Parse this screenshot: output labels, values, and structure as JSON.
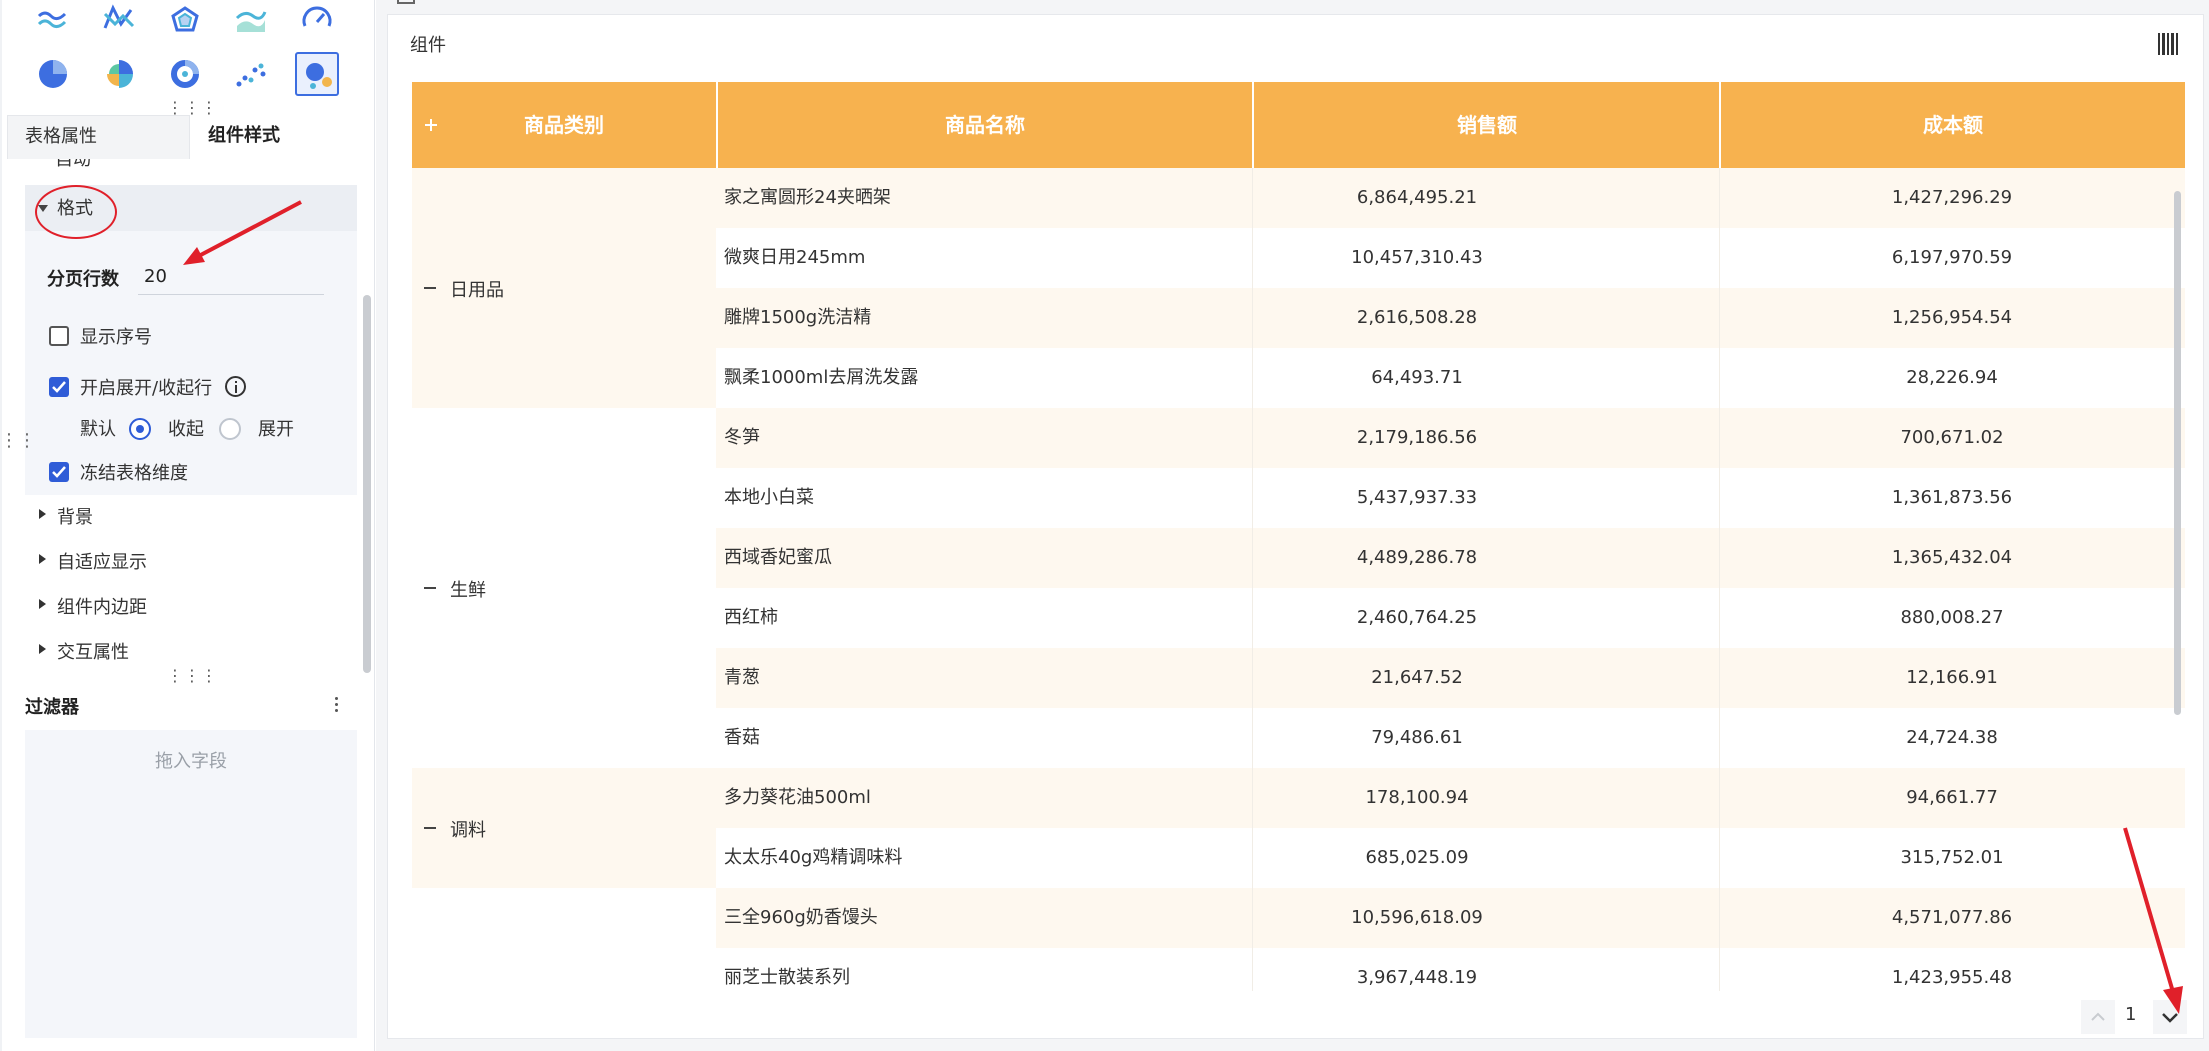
{
  "left_panel": {
    "tabs": [
      {
        "label": "表格属性"
      },
      {
        "label": "组件样式"
      }
    ],
    "cut_label": "自动",
    "format_section": {
      "title": "格式",
      "page_rows_label": "分页行数",
      "page_rows_value": "20",
      "show_index_label": "显示序号",
      "show_index_checked": false,
      "expand_collapse_label": "开启展开/收起行",
      "expand_collapse_checked": true,
      "default_label": "默认",
      "collapse_label": "收起",
      "expand_label": "展开",
      "default_value": "收起",
      "freeze_label": "冻结表格维度",
      "freeze_checked": true
    },
    "sections": [
      {
        "label": "背景"
      },
      {
        "label": "自适应显示"
      },
      {
        "label": "组件内边距"
      },
      {
        "label": "交互属性"
      }
    ],
    "filter": {
      "title": "过滤器",
      "drop_placeholder": "拖入字段"
    }
  },
  "chart_icons": [
    {
      "name": "area-line-icon"
    },
    {
      "name": "multi-line-icon"
    },
    {
      "name": "radar-icon"
    },
    {
      "name": "area-chart-icon"
    },
    {
      "name": "gauge-icon"
    },
    {
      "name": "pie-icon"
    },
    {
      "name": "rose-pie-icon"
    },
    {
      "name": "donut-icon"
    },
    {
      "name": "scatter-icon"
    },
    {
      "name": "bubble-icon"
    }
  ],
  "component": {
    "title": "组件",
    "columns": [
      "商品类别",
      "商品名称",
      "销售额",
      "成本额"
    ],
    "groups": [
      {
        "category": "日用品",
        "rows": [
          {
            "name": "家之寓圆形24夹晒架",
            "sales": "6,864,495.21",
            "cost": "1,427,296.29"
          },
          {
            "name": "微爽日用245mm",
            "sales": "10,457,310.43",
            "cost": "6,197,970.59"
          },
          {
            "name": "雕牌1500g洗洁精",
            "sales": "2,616,508.28",
            "cost": "1,256,954.54"
          },
          {
            "name": "飘柔1000ml去屑洗发露",
            "sales": "64,493.71",
            "cost": "28,226.94"
          }
        ]
      },
      {
        "category": "生鲜",
        "rows": [
          {
            "name": "冬笋",
            "sales": "2,179,186.56",
            "cost": "700,671.02"
          },
          {
            "name": "本地小白菜",
            "sales": "5,437,937.33",
            "cost": "1,361,873.56"
          },
          {
            "name": "西域香妃蜜瓜",
            "sales": "4,489,286.78",
            "cost": "1,365,432.04"
          },
          {
            "name": "西红柿",
            "sales": "2,460,764.25",
            "cost": "880,008.27"
          },
          {
            "name": "青葱",
            "sales": "21,647.52",
            "cost": "12,166.91"
          },
          {
            "name": "香菇",
            "sales": "79,486.61",
            "cost": "24,724.38"
          }
        ]
      },
      {
        "category": "调料",
        "rows": [
          {
            "name": "多力葵花油500ml",
            "sales": "178,100.94",
            "cost": "94,661.77"
          },
          {
            "name": "太太乐40g鸡精调味料",
            "sales": "685,025.09",
            "cost": "315,752.01"
          }
        ]
      },
      {
        "category": "",
        "rows": [
          {
            "name": "三全960g奶香馒头",
            "sales": "10,596,618.09",
            "cost": "4,571,077.86"
          },
          {
            "name": "丽芝士散装系列",
            "sales": "3,967,448.19",
            "cost": "1,423,955.48"
          }
        ]
      }
    ],
    "pager": {
      "current_page": "1"
    }
  },
  "colors": {
    "header_orange": "#f7b24f",
    "accent_blue": "#2f5cd7",
    "annotation_red": "#e0202a"
  }
}
